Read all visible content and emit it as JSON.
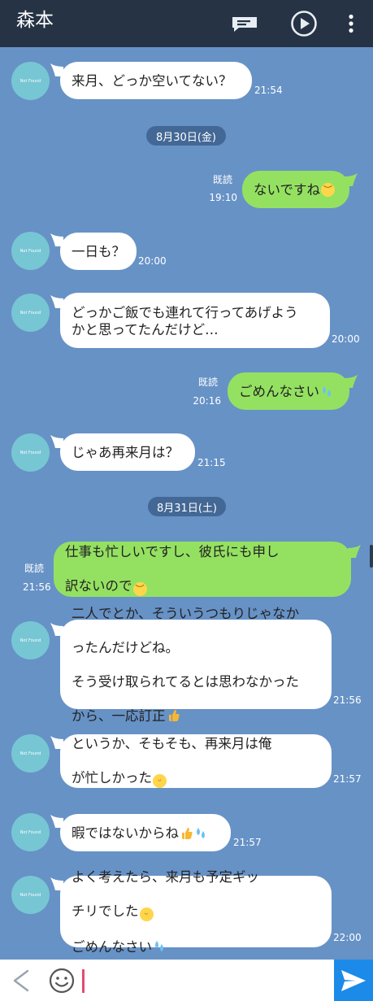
{
  "header": {
    "title": "森本",
    "icons": [
      "message-list-icon",
      "play-icon",
      "more-vert-icon"
    ]
  },
  "avatar_text": "Not Found",
  "messages": {
    "m1": {
      "text": "来月、どっか空いてない？",
      "time": "21:54"
    },
    "d1": {
      "text": "8月30日(金)"
    },
    "m2": {
      "text": "ないですね",
      "read": "既読",
      "time": "19:10"
    },
    "m3": {
      "text": "一日も？",
      "time": "20:00"
    },
    "m4": {
      "text": "どっかご飯でも連れて行ってあげよう\nかと思ってたんだけど…",
      "time": "20:00"
    },
    "m5": {
      "text": "ごめんなさい",
      "read": "既読",
      "time": "20:16"
    },
    "m6": {
      "text": "じゃあ再来月は？",
      "time": "21:15"
    },
    "d2": {
      "text": "8月31日(土)"
    },
    "m7": {
      "line1": "仕事も忙しいですし、彼氏にも申し",
      "line2": "訳ないので",
      "read": "既読",
      "time": "21:56"
    },
    "m8": {
      "line1": "二人でとか、そういうつもりじゃなか",
      "line2": "ったんだけどね。",
      "line3": "そう受け取られてるとは思わなかった",
      "line4": "から、一応訂正",
      "time": "21:56"
    },
    "m9": {
      "line1": "というか、そもそも、再来月は俺",
      "line2": "が忙しかった",
      "time": "21:57"
    },
    "m10": {
      "text": "暇ではないからね",
      "time": "21:57"
    },
    "m11": {
      "line1": "よく考えたら、来月も予定ギッ",
      "line2": "チリでした",
      "line3": "ごめんなさい",
      "time": "22:00"
    }
  },
  "footer": {
    "icons": [
      "back-chevron-icon",
      "emoji-icon",
      "send-icon"
    ],
    "input_value": ""
  },
  "colors": {
    "header_bg": "#253345",
    "chat_bg": "#6792c6",
    "incoming_bubble": "#ffffff",
    "outgoing_bubble": "#94e162",
    "send_button": "#1c8ae8",
    "avatar": "#77c6d4"
  }
}
